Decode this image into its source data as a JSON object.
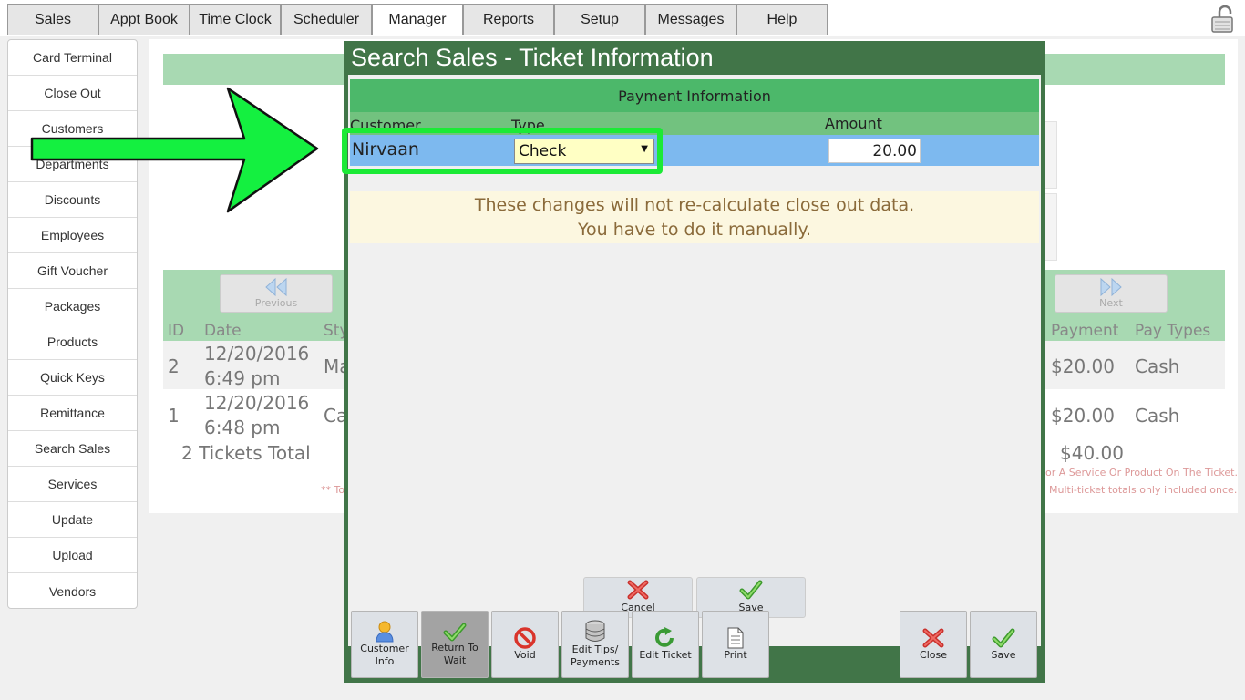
{
  "nav": {
    "tabs": [
      "Sales",
      "Appt Book",
      "Time Clock",
      "Scheduler",
      "Manager",
      "Reports",
      "Setup",
      "Messages",
      "Help"
    ],
    "active": "Manager"
  },
  "sidebar": {
    "items": [
      "Card Terminal",
      "Close Out",
      "Customers",
      "Departments",
      "Discounts",
      "Employees",
      "Gift Voucher",
      "Packages",
      "Products",
      "Quick Keys",
      "Remittance",
      "Search Sales",
      "Services",
      "Update",
      "Upload",
      "Vendors"
    ]
  },
  "background": {
    "previous_label": "Previous",
    "next_label": "Next",
    "columns": {
      "id": "ID",
      "date": "Date",
      "stylist": "Sty",
      "payment": "Payment",
      "pay_types": "Pay Types"
    },
    "rows": [
      {
        "id": "2",
        "date": "12/20/2016",
        "time": "6:49 pm",
        "stylist": "Ma",
        "payment": "$20.00",
        "pay_type": "Cash"
      },
      {
        "id": "1",
        "date": "12/20/2016",
        "time": "6:48 pm",
        "stylist": "Ca",
        "payment": "$20.00",
        "pay_type": "Cash"
      }
    ],
    "total_label": "2 Tickets Total",
    "total_value": "$40.00",
    "note_left": "** To",
    "note_right_1": "or A Service Or Product On The Ticket.",
    "note_right_2": "Multi-ticket totals only included once."
  },
  "modal": {
    "title": "Search Sales - Ticket Information",
    "payment_header": "Payment Information",
    "col_customer": "Customer",
    "col_type": "Type",
    "col_amount": "Amount",
    "row": {
      "customer": "Nirvaan",
      "type": "Check",
      "amount": "20.00"
    },
    "notice_line1": "These changes will not re-calculate close out data.",
    "notice_line2": "You have to do it manually.",
    "cancel_label": "Cancel",
    "save_label": "Save",
    "toolbar": {
      "customer_info": [
        "Customer",
        "Info"
      ],
      "return_to_wait": [
        "Return To",
        "Wait"
      ],
      "void": "Void",
      "edit_tips": [
        "Edit Tips/",
        "Payments"
      ],
      "edit_ticket": "Edit Ticket",
      "print": "Print",
      "close": "Close",
      "save": "Save"
    }
  },
  "colors": {
    "modal_frame": "#417548",
    "header_green": "#4cb86a",
    "row_blue": "#7db9ef",
    "highlight": "#1bea36",
    "select_bg": "#ffffc4"
  }
}
